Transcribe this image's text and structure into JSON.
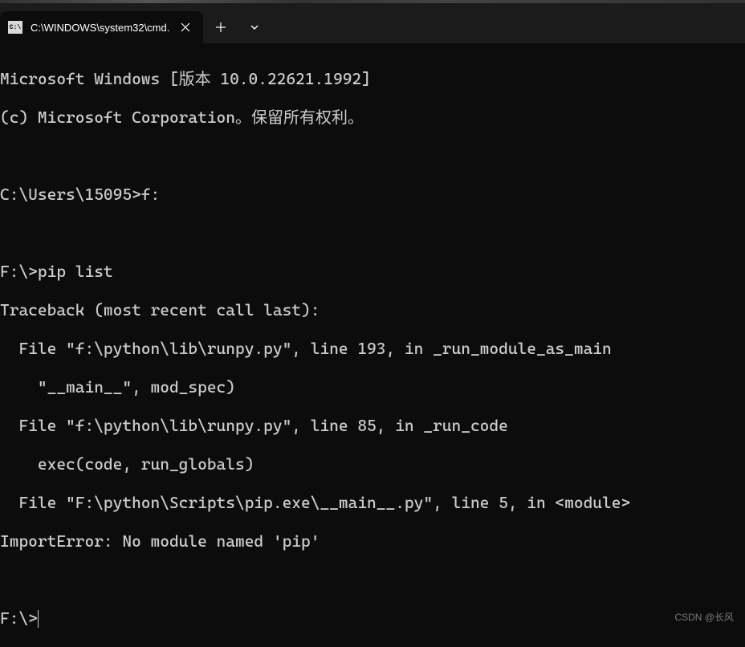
{
  "tab": {
    "title": "C:\\WINDOWS\\system32\\cmd.",
    "icon_label": "cmd-icon"
  },
  "terminal": {
    "lines": [
      "Microsoft Windows [版本 10.0.22621.1992]",
      "(c) Microsoft Corporation。保留所有权利。",
      "",
      "C:\\Users\\15095>f:",
      "",
      "F:\\>pip list",
      "Traceback (most recent call last):",
      "  File \"f:\\python\\lib\\runpy.py\", line 193, in _run_module_as_main",
      "    \"__main__\", mod_spec)",
      "  File \"f:\\python\\lib\\runpy.py\", line 85, in _run_code",
      "    exec(code, run_globals)",
      "  File \"F:\\python\\Scripts\\pip.exe\\__main__.py\", line 5, in <module>",
      "ImportError: No module named 'pip'",
      ""
    ],
    "prompt": "F:\\>"
  },
  "watermark": "CSDN @长风"
}
